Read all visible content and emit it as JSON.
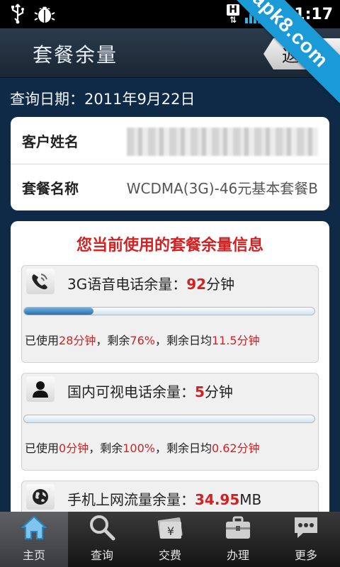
{
  "status_bar": {
    "network_type": "H",
    "time": "11:17"
  },
  "watermark": "apk8.com",
  "header": {
    "title": "套餐余量",
    "back_label": "返回"
  },
  "query_date": "查询日期：2011年9月22日",
  "account": {
    "name_label": "客户姓名",
    "name_value": "",
    "plan_label": "套餐名称",
    "plan_value": "WCDMA(3G)-46元基本套餐B"
  },
  "usage": {
    "title": "您当前使用的套餐余量信息",
    "items": [
      {
        "icon": "phone-icon",
        "label": "3G语音电话余量：",
        "value": "92",
        "unit": "分钟",
        "used_prefix": "已使用",
        "used": "28分钟",
        "remain_prefix": "，剩余",
        "remain_pct": "76%",
        "daily_prefix": "，剩余日均",
        "daily": "11.5分钟",
        "fraction_used": 0.24
      },
      {
        "icon": "person-icon",
        "label": "国内可视电话余量：",
        "value": "5",
        "unit": "分钟",
        "used_prefix": "已使用",
        "used": "0分钟",
        "remain_prefix": "，剩余",
        "remain_pct": "100%",
        "daily_prefix": "，剩余日均",
        "daily": "0.62分钟",
        "fraction_used": 0.0
      },
      {
        "icon": "globe-icon",
        "label": "手机上网流量余量：",
        "value": "34.95",
        "unit": "MB"
      }
    ]
  },
  "nav": [
    {
      "label": "主页",
      "icon": "home-icon",
      "active": true
    },
    {
      "label": "查询",
      "icon": "search-icon",
      "active": false
    },
    {
      "label": "交费",
      "icon": "payment-icon",
      "active": false
    },
    {
      "label": "办理",
      "icon": "briefcase-icon",
      "active": false
    },
    {
      "label": "更多",
      "icon": "more-icon",
      "active": false
    }
  ],
  "colors": {
    "accent_red": "#d42020",
    "progress_blue": "#2c6fa8",
    "background": "#0e2a47"
  }
}
